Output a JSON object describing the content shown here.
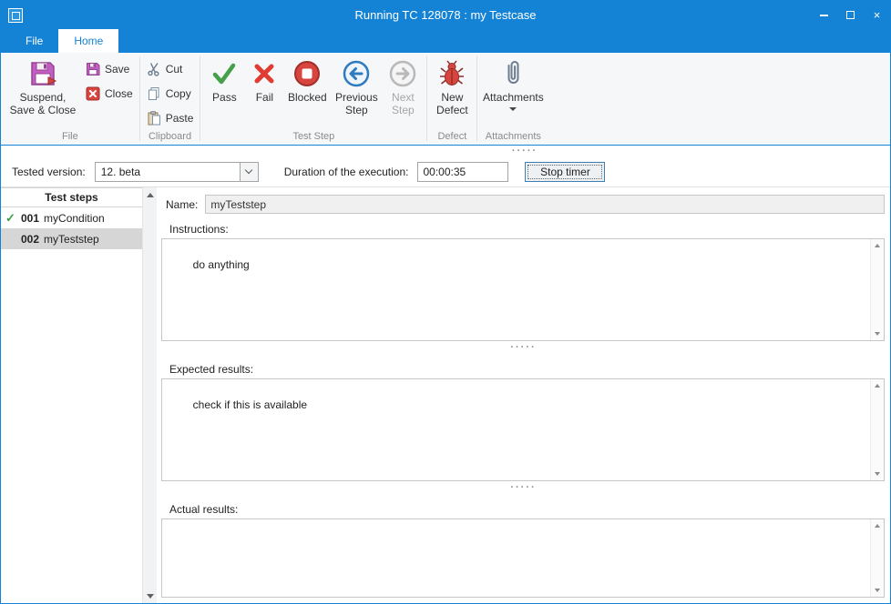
{
  "titlebar": {
    "title": "Running TC 128078 : my Testcase",
    "close_glyph": "×"
  },
  "menu": {
    "file_tab": "File",
    "home_tab": "Home"
  },
  "ribbon": {
    "file": {
      "label": "File",
      "suspend": "Suspend, Save & Close",
      "save": "Save",
      "close": "Close"
    },
    "clipboard": {
      "label": "Clipboard",
      "cut": "Cut",
      "copy": "Copy",
      "paste": "Paste"
    },
    "test_step": {
      "label": "Test Step",
      "pass": "Pass",
      "fail": "Fail",
      "blocked": "Blocked",
      "previous": "Previous Step",
      "next": "Next Step"
    },
    "defect": {
      "label": "Defect",
      "new_defect": "New Defect"
    },
    "attachments": {
      "label": "Attachments",
      "attachments": "Attachments"
    }
  },
  "exec_bar": {
    "tested_version_label": "Tested version:",
    "tested_version_value": "12. beta",
    "duration_label": "Duration of the execution:",
    "duration_value": "00:00:35",
    "stop_timer_label": "Stop timer"
  },
  "test_steps": {
    "header": "Test steps",
    "items": [
      {
        "number": "001",
        "name": "myCondition",
        "status_icon": "✓"
      },
      {
        "number": "002",
        "name": "myTeststep",
        "status_icon": ""
      }
    ]
  },
  "form": {
    "name_label": "Name:",
    "name_value": "myTeststep",
    "instructions_label": "Instructions:",
    "instructions_value": "do anything",
    "expected_label": "Expected results:",
    "expected_value": "check if this is available",
    "actual_label": "Actual results:",
    "actual_value": ""
  },
  "icons": {
    "gripper_dots": "·····"
  },
  "colors": {
    "titlebar_blue": "#1583d5",
    "pass_green": "#46a049",
    "fail_red": "#e03c31",
    "blocked_red": "#d8453e",
    "selected_row_gray": "#d6d6d6"
  }
}
